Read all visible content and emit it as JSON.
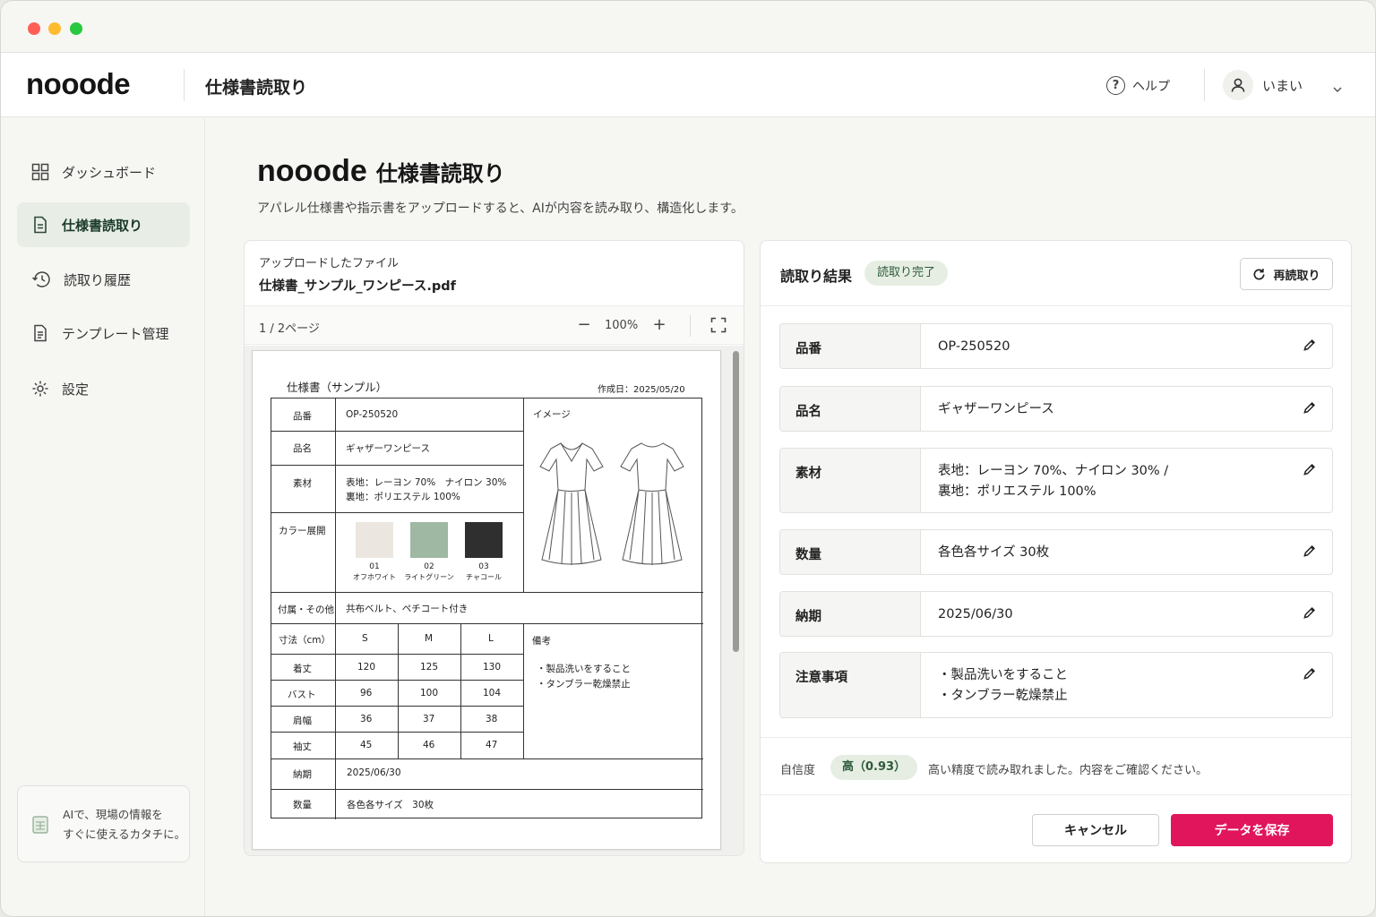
{
  "app": {
    "logo": "nooode",
    "section_title": "仕様書読取り"
  },
  "header": {
    "help_label": "ヘルプ",
    "user_name": "いまい"
  },
  "sidebar": {
    "items": [
      {
        "label": "ダッシュボード",
        "icon": "grid-icon"
      },
      {
        "label": "仕様書読取り",
        "icon": "document-icon",
        "active": true
      },
      {
        "label": "読取り履歴",
        "icon": "history-icon"
      },
      {
        "label": "テンプレート管理",
        "icon": "template-icon"
      },
      {
        "label": "設定",
        "icon": "gear-icon"
      }
    ],
    "tip_line1": "AIで、現場の情報を",
    "tip_line2": "すぐに使えるカタチに。"
  },
  "page": {
    "title_brand": "nooode",
    "title_sub": "仕様書読取り",
    "description": "アパレル仕様書や指示書をアップロードすると、AIが内容を読み取り、構造化します。"
  },
  "file": {
    "label": "アップロードしたファイル",
    "name": "仕様書_サンプル_ワンピース.pdf",
    "pages": "1 / 2ページ",
    "zoom": "100%"
  },
  "doc": {
    "title": "仕様書（サンプル）",
    "date": "作成日：2025/05/20",
    "rows": {
      "hinban_label": "品番",
      "hinban_value": "OP-250520",
      "hinmei_label": "品名",
      "hinmei_value": "ギャザーワンピース",
      "sozai_label": "素材",
      "sozai_line1": "表地：レーヨン 70%　ナイロン 30%",
      "sozai_line2": "裏地：ポリエステル 100%",
      "color_label": "カラー展開",
      "image_label": "イメージ",
      "fuzoku_label": "付属・その他",
      "fuzoku_value": "共布ベルト、ペチコート付き",
      "size_label": "寸法（cm）",
      "biko_label": "備考",
      "biko_line1": "・製品洗いをすること",
      "biko_line2": "・タンブラー乾燥禁止",
      "noki_label": "納期",
      "noki_value": "2025/06/30",
      "suryo_label": "数量",
      "suryo_value": "各色各サイズ　30枚"
    },
    "colors": [
      {
        "code": "01",
        "name": "オフホワイト",
        "hex": "#ebe6df"
      },
      {
        "code": "02",
        "name": "ライトグリーン",
        "hex": "#9fb8a3"
      },
      {
        "code": "03",
        "name": "チャコール",
        "hex": "#2f2f2f"
      }
    ],
    "sizes": [
      "S",
      "M",
      "L"
    ],
    "measurements": [
      {
        "name": "着丈",
        "values": [
          "120",
          "125",
          "130"
        ]
      },
      {
        "name": "バスト",
        "values": [
          "96",
          "100",
          "104"
        ]
      },
      {
        "name": "肩幅",
        "values": [
          "36",
          "37",
          "38"
        ]
      },
      {
        "name": "袖丈",
        "values": [
          "45",
          "46",
          "47"
        ]
      }
    ]
  },
  "result": {
    "title": "読取り結果",
    "status": "読取り完了",
    "reread_label": "再読取り",
    "fields": [
      {
        "label": "品番",
        "value": "OP-250520"
      },
      {
        "label": "品名",
        "value": "ギャザーワンピース"
      },
      {
        "label": "素材",
        "value": "表地：レーヨン 70%、ナイロン 30% /\n裏地：ポリエステル 100%"
      },
      {
        "label": "数量",
        "value": "各色各サイズ 30枚"
      },
      {
        "label": "納期",
        "value": "2025/06/30"
      },
      {
        "label": "注意事項",
        "value": "・製品洗いをすること\n・タンブラー乾燥禁止"
      }
    ],
    "confidence_label": "自信度",
    "confidence_value": "高（0.93）",
    "confidence_text": "高い精度で読み取れました。内容をご確認ください。",
    "cancel_label": "キャンセル",
    "save_label": "データを保存"
  },
  "colors": {
    "accent": "#e0155c",
    "active_nav_bg": "#e8ede6",
    "badge_bg": "#e6eee3"
  }
}
